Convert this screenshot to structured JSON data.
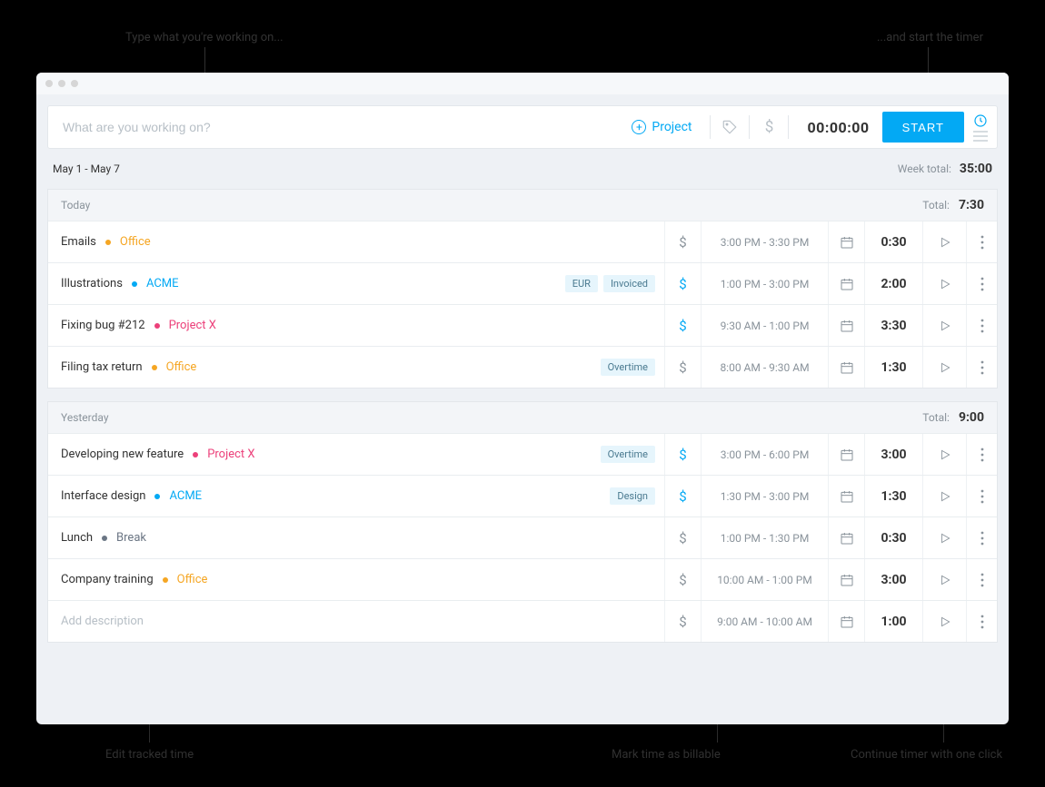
{
  "annotations": {
    "type_what": "Type what you're working on...",
    "start_timer": "...and start the timer",
    "edit_tracked": "Edit tracked time",
    "mark_billable": "Mark time as billable",
    "continue_timer": "Continue timer with one click"
  },
  "timer_bar": {
    "placeholder": "What are you working on?",
    "project_label": "Project",
    "timer_value": "00:00:00",
    "start_label": "START"
  },
  "week": {
    "range": "May 1 - May 7",
    "total_label": "Week total:",
    "total_value": "35:00"
  },
  "days": [
    {
      "label": "Today",
      "total_label": "Total:",
      "total_value": "7:30",
      "entries": [
        {
          "desc": "Emails",
          "project": "Office",
          "project_class": "office",
          "tags": [],
          "billable": false,
          "time_range": "3:00 PM - 3:30 PM",
          "duration": "0:30"
        },
        {
          "desc": "Illustrations",
          "project": "ACME",
          "project_class": "acme",
          "tags": [
            "EUR",
            "Invoiced"
          ],
          "billable": true,
          "time_range": "1:00 PM - 3:00 PM",
          "duration": "2:00"
        },
        {
          "desc": "Fixing bug #212",
          "project": "Project X",
          "project_class": "projectx",
          "tags": [],
          "billable": true,
          "time_range": "9:30 AM - 1:00 PM",
          "duration": "3:30"
        },
        {
          "desc": "Filing tax return",
          "project": "Office",
          "project_class": "office",
          "tags": [
            "Overtime"
          ],
          "billable": false,
          "time_range": "8:00 AM - 9:30 AM",
          "duration": "1:30"
        }
      ]
    },
    {
      "label": "Yesterday",
      "total_label": "Total:",
      "total_value": "9:00",
      "entries": [
        {
          "desc": "Developing new feature",
          "project": "Project X",
          "project_class": "projectx",
          "tags": [
            "Overtime"
          ],
          "billable": true,
          "time_range": "3:00 PM - 6:00 PM",
          "duration": "3:00"
        },
        {
          "desc": "Interface design",
          "project": "ACME",
          "project_class": "acme",
          "tags": [
            "Design"
          ],
          "billable": true,
          "time_range": "1:30 PM - 3:00 PM",
          "duration": "1:30"
        },
        {
          "desc": "Lunch",
          "project": "Break",
          "project_class": "break",
          "tags": [],
          "billable": false,
          "time_range": "1:00 PM - 1:30 PM",
          "duration": "0:30"
        },
        {
          "desc": "Company training",
          "project": "Office",
          "project_class": "office",
          "tags": [],
          "billable": false,
          "time_range": "10:00 AM - 1:00 PM",
          "duration": "3:00"
        },
        {
          "desc": "",
          "placeholder": "Add description",
          "project": "",
          "project_class": "",
          "tags": [],
          "billable": false,
          "time_range": "9:00 AM - 10:00 AM",
          "duration": "1:00"
        }
      ]
    }
  ]
}
